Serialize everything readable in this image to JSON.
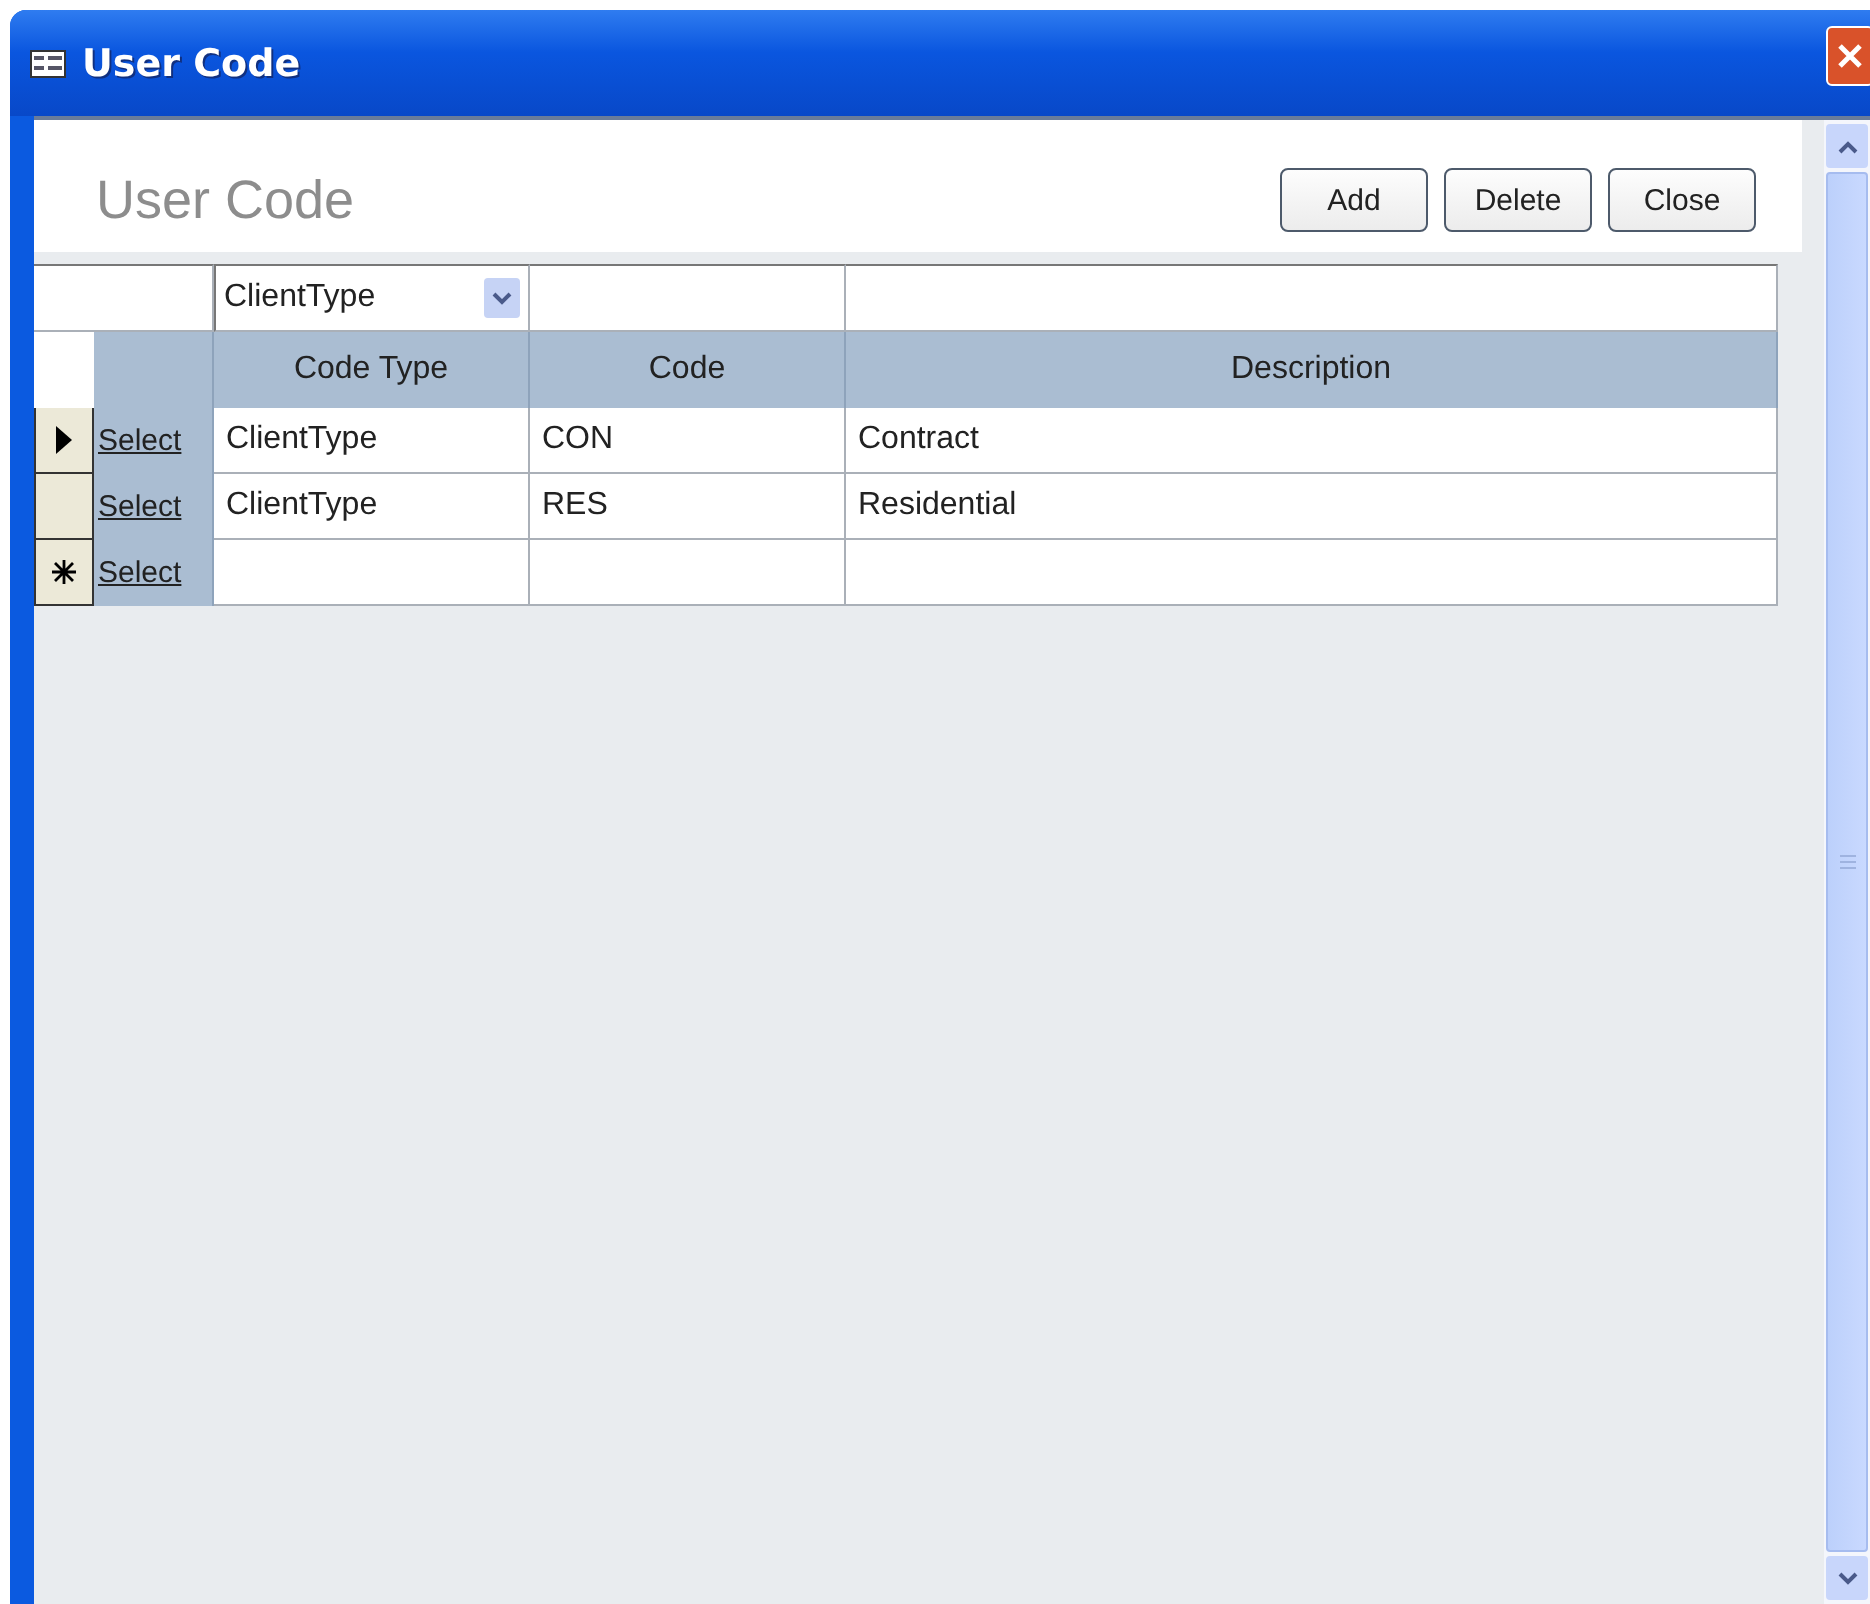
{
  "window": {
    "title": "User Code"
  },
  "form": {
    "heading": "User Code",
    "buttons": [
      "Add",
      "Delete",
      "Close"
    ]
  },
  "filter": {
    "value": "ClientType"
  },
  "table": {
    "columns": [
      "Code Type",
      "Code",
      "Description"
    ],
    "rows": [
      {
        "current": true,
        "new_record": false,
        "link": "Select",
        "cells": [
          "ClientType",
          "CON",
          "Contract"
        ]
      },
      {
        "current": false,
        "new_record": false,
        "link": "Select",
        "cells": [
          "ClientType",
          "RES",
          "Residential"
        ]
      },
      {
        "current": false,
        "new_record": true,
        "link": "Select",
        "cells": [
          "",
          "",
          ""
        ]
      }
    ]
  }
}
